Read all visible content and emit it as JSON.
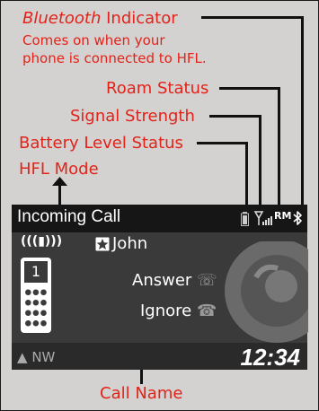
{
  "callouts": {
    "bluetooth_title_italic": "Bluetooth",
    "bluetooth_title_rest": " Indicator",
    "bluetooth_desc_line1": "Comes on when your",
    "bluetooth_desc_line2": "phone is connected to HFL.",
    "roam_status": "Roam Status",
    "signal_strength": "Signal Strength",
    "battery_level_status": "Battery Level Status",
    "hfl_mode": "HFL Mode",
    "call_name": "Call Name"
  },
  "screen": {
    "title": "Incoming Call",
    "status_icons": {
      "battery": "battery-icon",
      "signal": "signal-strength-icon",
      "roam": "RM",
      "bluetooth": "bluetooth-icon"
    },
    "call_indicator_icon": "incoming-call-waves-icon",
    "contact_icon": "star-contact-icon",
    "caller_name": "John",
    "options": {
      "answer": "Answer",
      "ignore": "Ignore"
    },
    "phone_button": "1",
    "compass": "NW",
    "clock": "12:34"
  },
  "colors": {
    "callout_red": "#e32219",
    "background": "#d4d2d0",
    "screen_bg": "#3a3a3a",
    "topbar_bg": "#161616"
  }
}
